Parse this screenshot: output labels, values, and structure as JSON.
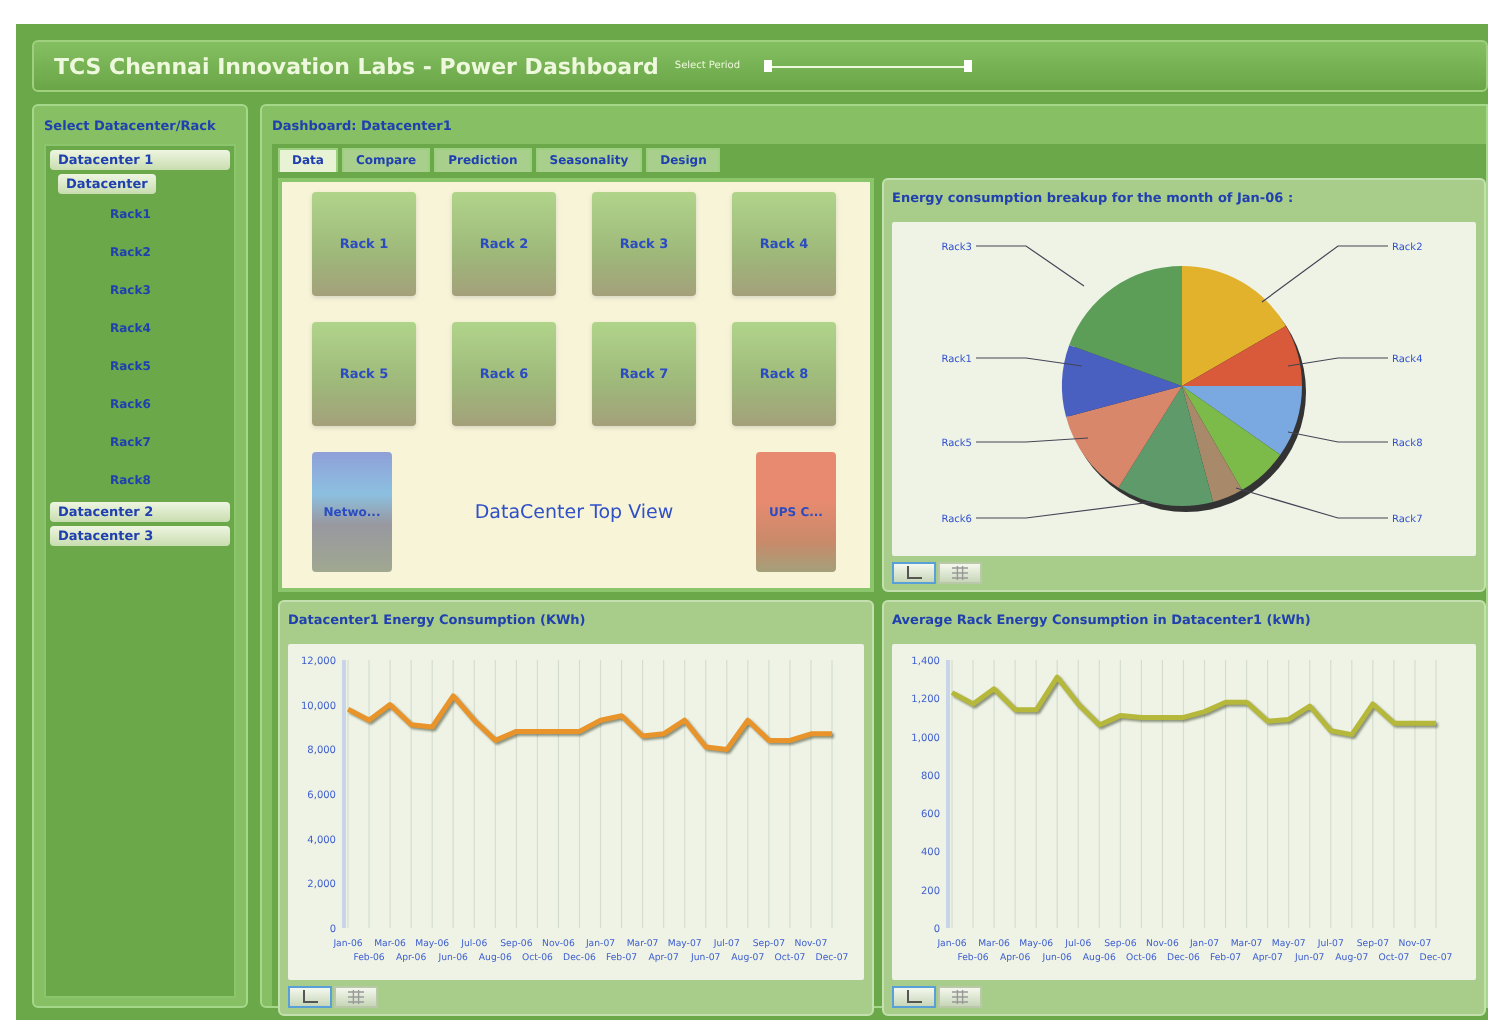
{
  "header": {
    "title": "TCS Chennai Innovation Labs - Power Dashboard",
    "period_label": "Select Period",
    "period_thumbs": [
      {
        "level": 0
      },
      {
        "level": 1
      }
    ]
  },
  "sidebar": {
    "title": "Select Datacenter/Rack",
    "tree": [
      {
        "label": "Datacenter 1",
        "children": [
          {
            "label": "Datacenter",
            "children": [
              {
                "label": "Rack1"
              },
              {
                "label": "Rack2"
              },
              {
                "label": "Rack3"
              },
              {
                "label": "Rack4"
              },
              {
                "label": "Rack5"
              },
              {
                "label": "Rack6"
              },
              {
                "label": "Rack7"
              },
              {
                "label": "Rack8"
              }
            ]
          }
        ]
      },
      {
        "label": "Datacenter 2"
      },
      {
        "label": "Datacenter 3"
      }
    ]
  },
  "dashboard": {
    "title": "Dashboard: Datacenter1",
    "tabs": [
      {
        "label": "Data",
        "selected": true
      },
      {
        "label": "Compare",
        "selected": false
      },
      {
        "label": "Prediction",
        "selected": false
      },
      {
        "label": "Seasonality",
        "selected": false
      },
      {
        "label": "Design",
        "selected": false
      }
    ],
    "top_view": {
      "racks": [
        {
          "label": "Rack 1"
        },
        {
          "label": "Rack 2"
        },
        {
          "label": "Rack 3"
        },
        {
          "label": "Rack 4"
        },
        {
          "label": "Rack 5"
        },
        {
          "label": "Rack 6"
        },
        {
          "label": "Rack 7"
        },
        {
          "label": "Rack 8"
        }
      ],
      "devices": [
        {
          "label": "Netwo...",
          "kind": "network"
        },
        {
          "label": "UPS C...",
          "kind": "ups"
        }
      ],
      "caption": "DataCenter Top View"
    },
    "pie_panel": {
      "title": "Energy consumption breakup for the month of Jan-06 :",
      "slice_labels": [
        "Rack3",
        "Rack2",
        "Rack1",
        "Rack4",
        "Rack5",
        "Rack8",
        "Rack6",
        "Rack7"
      ],
      "view_toggles": [
        {
          "kind": "chart",
          "selected": true
        },
        {
          "kind": "table",
          "selected": false
        }
      ]
    },
    "energy_panel": {
      "title": "Datacenter1 Energy Consumption (KWh)",
      "chart_data": {
        "type": "line",
        "categories": [
          "Jan-06",
          "Feb-06",
          "Mar-06",
          "Apr-06",
          "May-06",
          "Jun-06",
          "Jul-06",
          "Aug-06",
          "Sep-06",
          "Oct-06",
          "Nov-06",
          "Dec-06",
          "Jan-07",
          "Feb-07",
          "Mar-07",
          "Apr-07",
          "May-07",
          "Jun-07",
          "Jul-07",
          "Aug-07",
          "Sep-07",
          "Oct-07",
          "Nov-07",
          "Dec-07"
        ],
        "grid": true,
        "series": [
          {
            "color": "#e8942a",
            "values": [
              9800,
              9300,
              10000,
              9100,
              9000,
              10400,
              9300,
              8400,
              8800,
              8800,
              8800,
              8800,
              9300,
              9500,
              8600,
              8700,
              9300,
              8100,
              8000,
              9300,
              8400,
              8400,
              8700,
              8700
            ]
          }
        ],
        "ylim": [
          0,
          12000
        ],
        "yticks": [
          {
            "value": 0,
            "label": "0"
          },
          {
            "value": 2000,
            "label": "2,000"
          },
          {
            "value": 4000,
            "label": "4,000"
          },
          {
            "value": 6000,
            "label": "6,000"
          },
          {
            "value": 8000,
            "label": "8,000"
          },
          {
            "value": 10000,
            "label": "10,000"
          },
          {
            "value": 12000,
            "label": "12,000"
          }
        ]
      },
      "view_toggles": [
        {
          "kind": "chart",
          "selected": true
        },
        {
          "kind": "table",
          "selected": false
        }
      ]
    },
    "average_panel": {
      "title": "Average Rack Energy Consumption in Datacenter1 (kWh)",
      "chart_data": {
        "type": "line",
        "categories": [
          "Jan-06",
          "Feb-06",
          "Mar-06",
          "Apr-06",
          "May-06",
          "Jun-06",
          "Jul-06",
          "Aug-06",
          "Sep-06",
          "Oct-06",
          "Nov-06",
          "Dec-06",
          "Jan-07",
          "Feb-07",
          "Mar-07",
          "Apr-07",
          "May-07",
          "Jun-07",
          "Jul-07",
          "Aug-07",
          "Sep-07",
          "Oct-07",
          "Nov-07",
          "Dec-07"
        ],
        "grid": true,
        "series": [
          {
            "color": "#b5b83a",
            "values": [
              1230,
              1170,
              1250,
              1140,
              1140,
              1310,
              1170,
              1060,
              1110,
              1100,
              1100,
              1100,
              1130,
              1180,
              1180,
              1080,
              1090,
              1160,
              1030,
              1010,
              1170,
              1070,
              1070,
              1070
            ]
          }
        ],
        "ylim": [
          0,
          1400
        ],
        "yticks": [
          {
            "value": 0,
            "label": "0"
          },
          {
            "value": 200,
            "label": "200"
          },
          {
            "value": 400,
            "label": "400"
          },
          {
            "value": 600,
            "label": "600"
          },
          {
            "value": 800,
            "label": "800"
          },
          {
            "value": 1000,
            "label": "1,000"
          },
          {
            "value": 1200,
            "label": "1,200"
          },
          {
            "value": 1400,
            "label": "1,400"
          }
        ]
      },
      "view_toggles": [
        {
          "kind": "chart",
          "selected": true
        },
        {
          "kind": "table",
          "selected": false
        }
      ]
    }
  }
}
